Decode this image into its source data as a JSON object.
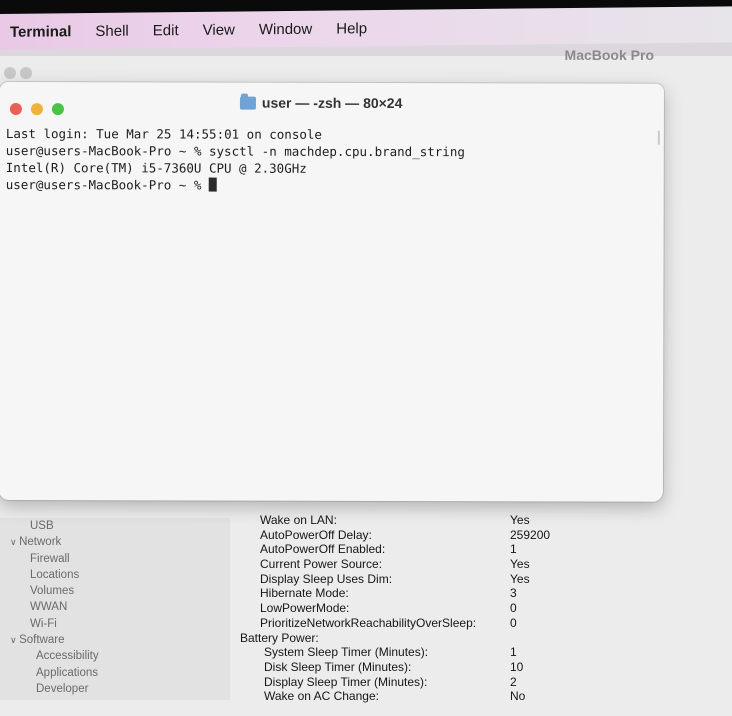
{
  "menubar": {
    "app": "Terminal",
    "items": [
      "Shell",
      "Edit",
      "View",
      "Window",
      "Help"
    ]
  },
  "background_window": {
    "title": "MacBook Pro",
    "sidebar": [
      {
        "label": "USB",
        "level": 2
      },
      {
        "label": "Network",
        "level": 1,
        "expanded": true
      },
      {
        "label": "Firewall",
        "level": 2
      },
      {
        "label": "Locations",
        "level": 2
      },
      {
        "label": "Volumes",
        "level": 2
      },
      {
        "label": "WWAN",
        "level": 2
      },
      {
        "label": "Wi-Fi",
        "level": 2
      },
      {
        "label": "Software",
        "level": 1,
        "expanded": true
      },
      {
        "label": "Accessibility",
        "level": 3
      },
      {
        "label": "Applications",
        "level": 3
      },
      {
        "label": "Developer",
        "level": 3
      }
    ],
    "details": [
      {
        "key": "Wake on LAN:",
        "value": "Yes",
        "indent": 1
      },
      {
        "key": "AutoPowerOff Delay:",
        "value": "259200",
        "indent": 1
      },
      {
        "key": "AutoPowerOff Enabled:",
        "value": "1",
        "indent": 1
      },
      {
        "key": "Current Power Source:",
        "value": "Yes",
        "indent": 1
      },
      {
        "key": "Display Sleep Uses Dim:",
        "value": "Yes",
        "indent": 1
      },
      {
        "key": "Hibernate Mode:",
        "value": "3",
        "indent": 1
      },
      {
        "key": "LowPowerMode:",
        "value": "0",
        "indent": 1
      },
      {
        "key": "PrioritizeNetworkReachabilityOverSleep:",
        "value": "0",
        "indent": 1
      },
      {
        "key": "Battery Power:",
        "value": "",
        "indent": 0
      },
      {
        "key": "System Sleep Timer (Minutes):",
        "value": "1",
        "indent": 2
      },
      {
        "key": "Disk Sleep Timer (Minutes):",
        "value": "10",
        "indent": 2
      },
      {
        "key": "Display Sleep Timer (Minutes):",
        "value": "2",
        "indent": 2
      },
      {
        "key": "Wake on AC Change:",
        "value": "No",
        "indent": 2
      }
    ]
  },
  "terminal": {
    "title": "user — -zsh — 80×24",
    "lines": [
      "Last login: Tue Mar 25 14:55:01 on console",
      "user@users-MacBook-Pro ~ % sysctl -n machdep.cpu.brand_string",
      "Intel(R) Core(TM) i5-7360U CPU @ 2.30GHz",
      "user@users-MacBook-Pro ~ % "
    ],
    "colors": {
      "close": "#ec5f57",
      "minimize": "#f0b33a",
      "zoom": "#47c446"
    },
    "icon": "folder-icon"
  }
}
